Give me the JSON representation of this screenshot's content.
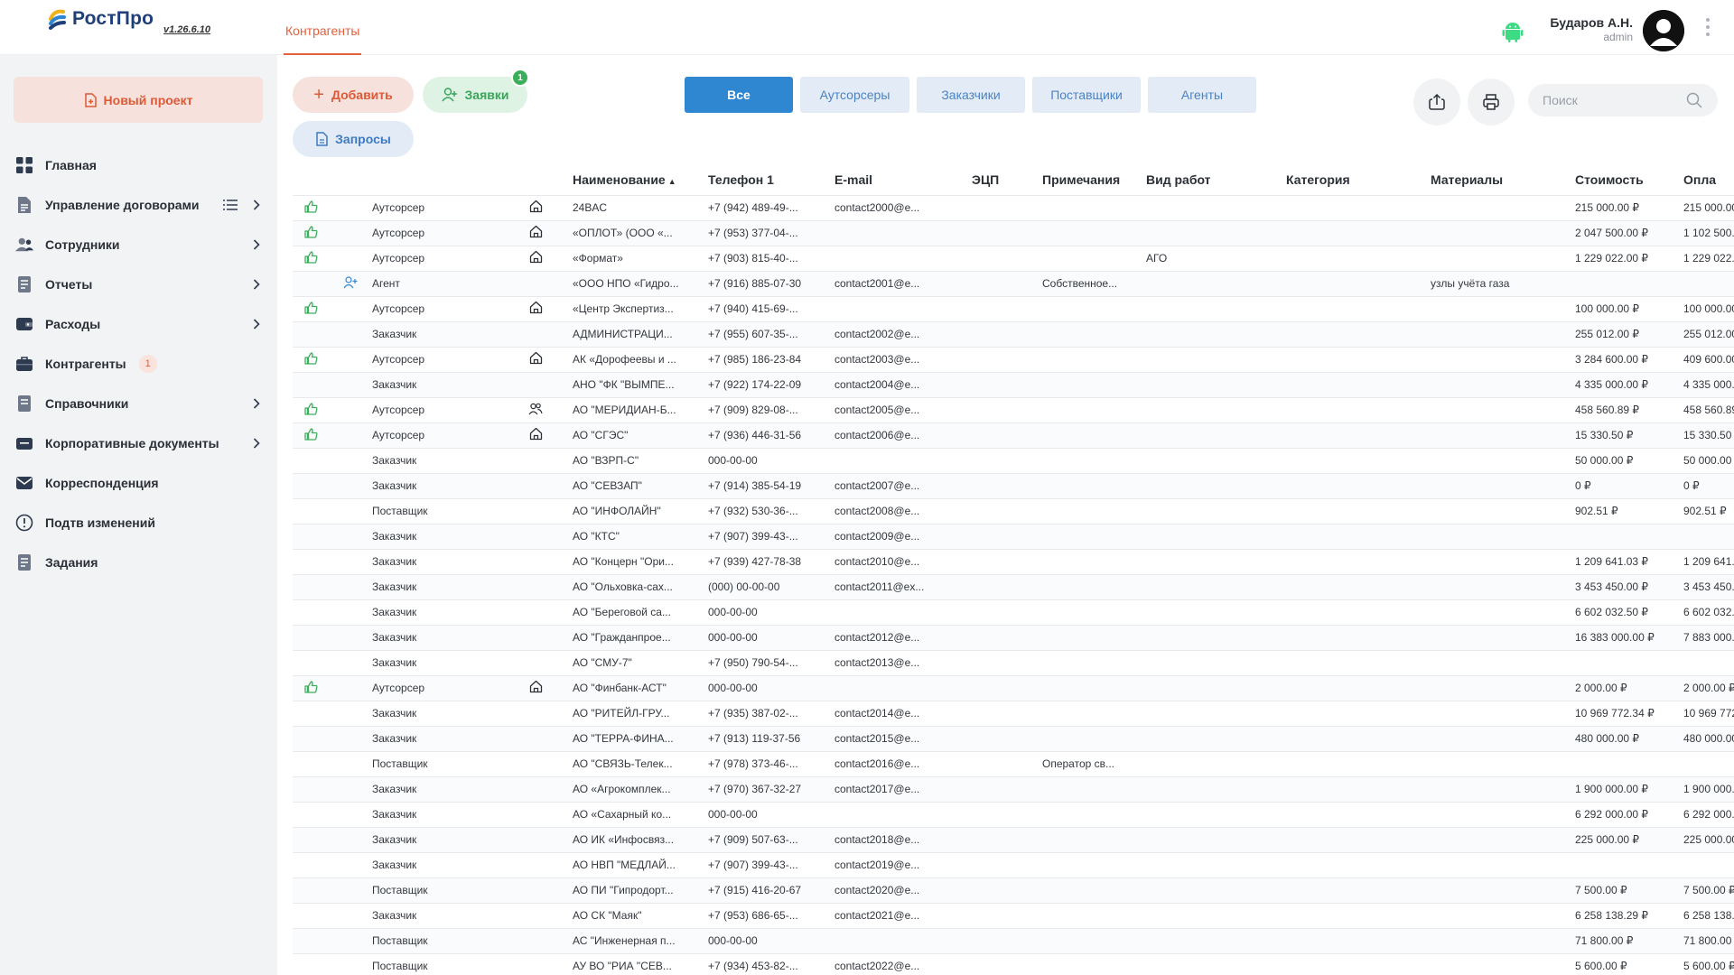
{
  "header": {
    "logo_text": "РостПро",
    "version": "v1.26.6.10",
    "active_tab": "Контрагенты",
    "user_name": "Бударов А.Н.",
    "user_role": "admin"
  },
  "sidebar": {
    "new_project": "Новый проект",
    "items": [
      {
        "label": "Главная",
        "icon": "grid-icon"
      },
      {
        "label": "Управление договорами",
        "icon": "document-icon",
        "list": true,
        "chevron": true
      },
      {
        "label": "Сотрудники",
        "icon": "users-icon",
        "chevron": true
      },
      {
        "label": "Отчеты",
        "icon": "report-icon",
        "chevron": true
      },
      {
        "label": "Расходы",
        "icon": "wallet-icon",
        "chevron": true
      },
      {
        "label": "Контрагенты",
        "icon": "briefcase-icon",
        "badge": "1"
      },
      {
        "label": "Справочники",
        "icon": "book-icon",
        "chevron": true
      },
      {
        "label": "Корпоративные документы",
        "icon": "folder-icon",
        "chevron": true
      },
      {
        "label": "Корреспонденция",
        "icon": "mail-icon"
      },
      {
        "label": "Подтв изменений",
        "icon": "alert-icon"
      },
      {
        "label": "Задания",
        "icon": "tasks-icon"
      }
    ]
  },
  "toolbar": {
    "add_label": "Добавить",
    "requests_label": "Заявки",
    "requests_badge": "1",
    "queries_label": "Запросы",
    "search_placeholder": "Поиск"
  },
  "filters": [
    "Все",
    "Аутсорсеры",
    "Заказчики",
    "Поставщики",
    "Агенты"
  ],
  "table": {
    "columns": [
      "Наименование",
      "Телефон 1",
      "E-mail",
      "ЭЦП",
      "Примечания",
      "Вид работ",
      "Категория",
      "Материалы",
      "Стоимость",
      "Опла"
    ],
    "rows": [
      {
        "thumb": true,
        "agent": false,
        "type": "Аутсорсер",
        "kind": "house",
        "name": "24BAC",
        "phone": "+7 (942) 489-49-...",
        "email": "contact2000@e...",
        "ecp": "",
        "notes": "",
        "work": "",
        "cat": "",
        "mat": "",
        "cost": "215 000.00 ₽",
        "paid": "215 000.00 ₽"
      },
      {
        "thumb": true,
        "agent": false,
        "type": "Аутсорсер",
        "kind": "house",
        "name": "«ОПЛОТ» (ООО «...",
        "phone": "+7 (953) 377-04-...",
        "email": "",
        "ecp": "",
        "notes": "",
        "work": "",
        "cat": "",
        "mat": "",
        "cost": "2 047 500.00 ₽",
        "paid": "1 102 500.00 ₽"
      },
      {
        "thumb": true,
        "agent": false,
        "type": "Аутсорсер",
        "kind": "house",
        "name": "«Формат»",
        "phone": "+7 (903) 815-40-...",
        "email": "",
        "ecp": "",
        "notes": "",
        "work": "АГО",
        "cat": "",
        "mat": "",
        "cost": "1 229 022.00 ₽",
        "paid": "1 229 022.00 ₽"
      },
      {
        "thumb": false,
        "agent": true,
        "type": "Агент",
        "kind": "",
        "name": "«ООО НПО «Гидро...",
        "phone": "+7 (916) 885-07-30",
        "email": "contact2001@e...",
        "ecp": "",
        "notes": "Собственное...",
        "work": "",
        "cat": "",
        "mat": "узлы учёта газа",
        "cost": "",
        "paid": ""
      },
      {
        "thumb": true,
        "agent": false,
        "type": "Аутсорсер",
        "kind": "house",
        "name": "«Центр Экспертиз...",
        "phone": "+7 (940) 415-69-...",
        "email": "",
        "ecp": "",
        "notes": "",
        "work": "",
        "cat": "",
        "mat": "",
        "cost": "100 000.00 ₽",
        "paid": "100 000.00 ₽"
      },
      {
        "thumb": false,
        "agent": false,
        "type": "Заказчик",
        "kind": "",
        "name": "АДМИНИСТРАЦИ...",
        "phone": "+7 (955) 607-35-...",
        "email": "contact2002@e...",
        "ecp": "",
        "notes": "",
        "work": "",
        "cat": "",
        "mat": "",
        "cost": "255 012.00 ₽",
        "paid": "255 012.00 ₽"
      },
      {
        "thumb": true,
        "agent": false,
        "type": "Аутсорсер",
        "kind": "house",
        "name": "АК «Дорофеевы и ...",
        "phone": "+7 (985) 186-23-84",
        "email": "contact2003@e...",
        "ecp": "",
        "notes": "",
        "work": "",
        "cat": "",
        "mat": "",
        "cost": "3 284 600.00 ₽",
        "paid": "409 600.00 ₽"
      },
      {
        "thumb": false,
        "agent": false,
        "type": "Заказчик",
        "kind": "",
        "name": "АНО \"ФК \"ВЫМПЕ...",
        "phone": "+7 (922) 174-22-09",
        "email": "contact2004@e...",
        "ecp": "",
        "notes": "",
        "work": "",
        "cat": "",
        "mat": "",
        "cost": "4 335 000.00 ₽",
        "paid": "4 335 000.00 ₽"
      },
      {
        "thumb": true,
        "agent": false,
        "type": "Аутсорсер",
        "kind": "people",
        "name": "АО \"МЕРИДИАН-Б...",
        "phone": "+7 (909) 829-08-...",
        "email": "contact2005@e...",
        "ecp": "",
        "notes": "",
        "work": "",
        "cat": "",
        "mat": "",
        "cost": "458 560.89 ₽",
        "paid": "458 560.89 ₽"
      },
      {
        "thumb": true,
        "agent": false,
        "type": "Аутсорсер",
        "kind": "house",
        "name": "АО \"СГЭС\"",
        "phone": "+7 (936) 446-31-56",
        "email": "contact2006@e...",
        "ecp": "",
        "notes": "",
        "work": "",
        "cat": "",
        "mat": "",
        "cost": "15 330.50 ₽",
        "paid": "15 330.50 ₽"
      },
      {
        "thumb": false,
        "agent": false,
        "type": "Заказчик",
        "kind": "",
        "name": "АО \"ВЗРП-С\"",
        "phone": "000-00-00",
        "email": "",
        "ecp": "",
        "notes": "",
        "work": "",
        "cat": "",
        "mat": "",
        "cost": "50 000.00 ₽",
        "paid": "50 000.00 ₽"
      },
      {
        "thumb": false,
        "agent": false,
        "type": "Заказчик",
        "kind": "",
        "name": "АО \"СЕВЗАП\"",
        "phone": "+7 (914) 385-54-19",
        "email": "contact2007@e...",
        "ecp": "",
        "notes": "",
        "work": "",
        "cat": "",
        "mat": "",
        "cost": "0 ₽",
        "paid": "0 ₽"
      },
      {
        "thumb": false,
        "agent": false,
        "type": "Поставщик",
        "kind": "",
        "name": "АО \"ИНФОЛАЙН\"",
        "phone": "+7 (932) 530-36-...",
        "email": "contact2008@e...",
        "ecp": "",
        "notes": "",
        "work": "",
        "cat": "",
        "mat": "",
        "cost": "902.51 ₽",
        "paid": "902.51 ₽"
      },
      {
        "thumb": false,
        "agent": false,
        "type": "Заказчик",
        "kind": "",
        "name": "АО \"КТС\"",
        "phone": "+7 (907) 399-43-...",
        "email": "contact2009@e...",
        "ecp": "",
        "notes": "",
        "work": "",
        "cat": "",
        "mat": "",
        "cost": "",
        "paid": ""
      },
      {
        "thumb": false,
        "agent": false,
        "type": "Заказчик",
        "kind": "",
        "name": "АО \"Концерн \"Ори...",
        "phone": "+7 (939) 427-78-38",
        "email": "contact2010@e...",
        "ecp": "",
        "notes": "",
        "work": "",
        "cat": "",
        "mat": "",
        "cost": "1 209 641.03 ₽",
        "paid": "1 209 641.03 ₽"
      },
      {
        "thumb": false,
        "agent": false,
        "type": "Заказчик",
        "kind": "",
        "name": "АО \"Ольховка-сах...",
        "phone": "(000) 00-00-00",
        "email": "contact2011@ex...",
        "ecp": "",
        "notes": "",
        "work": "",
        "cat": "",
        "mat": "",
        "cost": "3 453 450.00 ₽",
        "paid": "3 453 450.00 ₽"
      },
      {
        "thumb": false,
        "agent": false,
        "type": "Заказчик",
        "kind": "",
        "name": "АО \"Береговой са...",
        "phone": "000-00-00",
        "email": "",
        "ecp": "",
        "notes": "",
        "work": "",
        "cat": "",
        "mat": "",
        "cost": "6 602 032.50 ₽",
        "paid": "6 602 032.50 ₽"
      },
      {
        "thumb": false,
        "agent": false,
        "type": "Заказчик",
        "kind": "",
        "name": "АО \"Гражданпрое...",
        "phone": "000-00-00",
        "email": "contact2012@e...",
        "ecp": "",
        "notes": "",
        "work": "",
        "cat": "",
        "mat": "",
        "cost": "16 383 000.00 ₽",
        "paid": "7 883 000.00 ₽"
      },
      {
        "thumb": false,
        "agent": false,
        "type": "Заказчик",
        "kind": "",
        "name": "АО \"СМУ-7\"",
        "phone": "+7 (950) 790-54-...",
        "email": "contact2013@e...",
        "ecp": "",
        "notes": "",
        "work": "",
        "cat": "",
        "mat": "",
        "cost": "",
        "paid": ""
      },
      {
        "thumb": true,
        "agent": false,
        "type": "Аутсорсер",
        "kind": "house",
        "name": "АО \"Финбанк-АСТ\"",
        "phone": "000-00-00",
        "email": "",
        "ecp": "",
        "notes": "",
        "work": "",
        "cat": "",
        "mat": "",
        "cost": "2 000.00 ₽",
        "paid": "2 000.00 ₽"
      },
      {
        "thumb": false,
        "agent": false,
        "type": "Заказчик",
        "kind": "",
        "name": "АО \"РИТЕЙЛ-ГРУ...",
        "phone": "+7 (935) 387-02-...",
        "email": "contact2014@e...",
        "ecp": "",
        "notes": "",
        "work": "",
        "cat": "",
        "mat": "",
        "cost": "10 969 772.34 ₽",
        "paid": "10 969 772.34 ₽"
      },
      {
        "thumb": false,
        "agent": false,
        "type": "Заказчик",
        "kind": "",
        "name": "АО \"ТЕРРА-ФИНА...",
        "phone": "+7 (913) 119-37-56",
        "email": "contact2015@e...",
        "ecp": "",
        "notes": "",
        "work": "",
        "cat": "",
        "mat": "",
        "cost": "480 000.00 ₽",
        "paid": "480 000.00 ₽"
      },
      {
        "thumb": false,
        "agent": false,
        "type": "Поставщик",
        "kind": "",
        "name": "АО \"СВЯЗЬ-Телек...",
        "phone": "+7 (978) 373-46-...",
        "email": "contact2016@e...",
        "ecp": "",
        "notes": "Оператор св...",
        "work": "",
        "cat": "",
        "mat": "",
        "cost": "",
        "paid": ""
      },
      {
        "thumb": false,
        "agent": false,
        "type": "Заказчик",
        "kind": "",
        "name": "АО «Агрокомплек...",
        "phone": "+7 (970) 367-32-27",
        "email": "contact2017@e...",
        "ecp": "",
        "notes": "",
        "work": "",
        "cat": "",
        "mat": "",
        "cost": "1 900 000.00 ₽",
        "paid": "1 900 000.00 ₽"
      },
      {
        "thumb": false,
        "agent": false,
        "type": "Заказчик",
        "kind": "",
        "name": "АО «Сахарный ко...",
        "phone": "000-00-00",
        "email": "",
        "ecp": "",
        "notes": "",
        "work": "",
        "cat": "",
        "mat": "",
        "cost": "6 292 000.00 ₽",
        "paid": "6 292 000.00 ₽"
      },
      {
        "thumb": false,
        "agent": false,
        "type": "Заказчик",
        "kind": "",
        "name": "АО ИК «Инфосвяз...",
        "phone": "+7 (909) 507-63-...",
        "email": "contact2018@e...",
        "ecp": "",
        "notes": "",
        "work": "",
        "cat": "",
        "mat": "",
        "cost": "225 000.00 ₽",
        "paid": "225 000.00 ₽"
      },
      {
        "thumb": false,
        "agent": false,
        "type": "Заказчик",
        "kind": "",
        "name": "АО НВП \"МЕДЛАЙ...",
        "phone": "+7 (907) 399-43-...",
        "email": "contact2019@e...",
        "ecp": "",
        "notes": "",
        "work": "",
        "cat": "",
        "mat": "",
        "cost": "",
        "paid": ""
      },
      {
        "thumb": false,
        "agent": false,
        "type": "Поставщик",
        "kind": "",
        "name": "АО ПИ \"Гипродорт...",
        "phone": "+7 (915) 416-20-67",
        "email": "contact2020@e...",
        "ecp": "",
        "notes": "",
        "work": "",
        "cat": "",
        "mat": "",
        "cost": "7 500.00 ₽",
        "paid": "7 500.00 ₽"
      },
      {
        "thumb": false,
        "agent": false,
        "type": "Заказчик",
        "kind": "",
        "name": "АО СК \"Маяк\"",
        "phone": "+7 (953) 686-65-...",
        "email": "contact2021@e...",
        "ecp": "",
        "notes": "",
        "work": "",
        "cat": "",
        "mat": "",
        "cost": "6 258 138.29 ₽",
        "paid": "6 258 138.29 ₽"
      },
      {
        "thumb": false,
        "agent": false,
        "type": "Поставщик",
        "kind": "",
        "name": "АС \"Инженерная п...",
        "phone": "000-00-00",
        "email": "",
        "ecp": "",
        "notes": "",
        "work": "",
        "cat": "",
        "mat": "",
        "cost": "71 800.00 ₽",
        "paid": "71 800.00 ₽"
      },
      {
        "thumb": false,
        "agent": false,
        "type": "Поставщик",
        "kind": "",
        "name": "АУ ВО \"РИА \"СЕВ...",
        "phone": "+7 (934) 453-82-...",
        "email": "contact2022@e...",
        "ecp": "",
        "notes": "",
        "work": "",
        "cat": "",
        "mat": "",
        "cost": "5 600.00 ₽",
        "paid": "5 600.00 ₽"
      }
    ]
  }
}
